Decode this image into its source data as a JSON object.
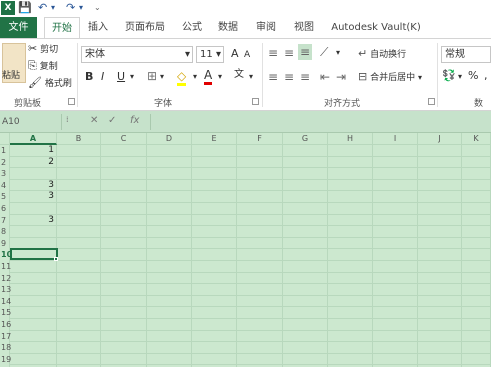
{
  "app": {
    "logo_text": "X"
  },
  "tabs": [
    {
      "label": "文件"
    },
    {
      "label": "开始"
    },
    {
      "label": "插入"
    },
    {
      "label": "页面布局"
    },
    {
      "label": "公式"
    },
    {
      "label": "数据"
    },
    {
      "label": "审阅"
    },
    {
      "label": "视图"
    },
    {
      "label": "Autodesk Vault(K)"
    }
  ],
  "ribbon": {
    "clipboard": {
      "paste": "粘贴",
      "cut": "剪切",
      "copy": "复制",
      "format_painter": "格式刷",
      "group": "剪贴板"
    },
    "font": {
      "name": "宋体",
      "size": "11",
      "bold": "B",
      "italic": "I",
      "underline": "U",
      "group": "字体",
      "grow": "A",
      "shrink": "A",
      "font_color": "A",
      "phonetic": "文"
    },
    "alignment": {
      "wrap": "自动换行",
      "merge": "合并后居中",
      "group": "对齐方式"
    },
    "number": {
      "format": "常规",
      "percent": "%",
      "group": "数字"
    }
  },
  "formula_bar": {
    "name_box": "A10",
    "fx": "fx",
    "value": ""
  },
  "columns": [
    "A",
    "B",
    "C",
    "D",
    "E",
    "F",
    "G",
    "H",
    "I",
    "J",
    "K"
  ],
  "rows": [
    "1",
    "2",
    "3",
    "4",
    "5",
    "6",
    "7",
    "8",
    "9",
    "10",
    "11",
    "12",
    "13",
    "14",
    "15",
    "16",
    "17",
    "18",
    "19"
  ],
  "cells": {
    "A1": "1",
    "A2": "2",
    "A4": "3",
    "A5": "3",
    "A7": "3"
  },
  "active_cell": "A10"
}
